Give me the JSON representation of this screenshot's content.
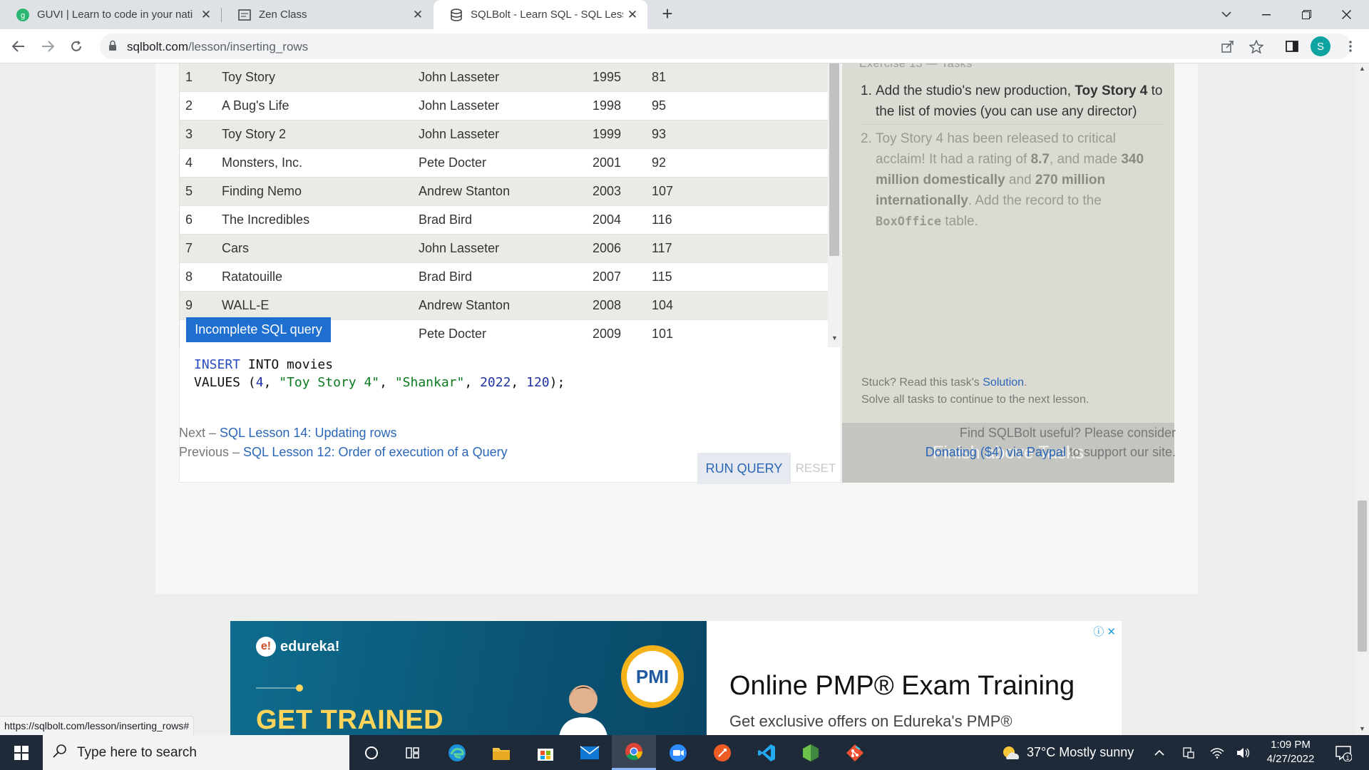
{
  "browser": {
    "tabs": [
      {
        "title": "GUVI | Learn to code in your nati",
        "icon": "guvi-icon",
        "active": false
      },
      {
        "title": "Zen Class",
        "icon": "zen-class-icon",
        "active": false
      },
      {
        "title": "SQLBolt - Learn SQL - SQL Lesson",
        "icon": "sqlbolt-icon",
        "active": true
      }
    ],
    "new_tab": "+",
    "url_host": "sqlbolt.com",
    "url_path": "/lesson/inserting_rows",
    "profile_initial": "S",
    "status_url": "https://sqlbolt.com/lesson/inserting_rows#"
  },
  "movies_table": {
    "rows": [
      {
        "id": "1",
        "title": "Toy Story",
        "director": "John Lasseter",
        "year": "1995",
        "length": "81"
      },
      {
        "id": "2",
        "title": "A Bug's Life",
        "director": "John Lasseter",
        "year": "1998",
        "length": "95"
      },
      {
        "id": "3",
        "title": "Toy Story 2",
        "director": "John Lasseter",
        "year": "1999",
        "length": "93"
      },
      {
        "id": "4",
        "title": "Monsters, Inc.",
        "director": "Pete Docter",
        "year": "2001",
        "length": "92"
      },
      {
        "id": "5",
        "title": "Finding Nemo",
        "director": "Andrew Stanton",
        "year": "2003",
        "length": "107"
      },
      {
        "id": "6",
        "title": "The Incredibles",
        "director": "Brad Bird",
        "year": "2004",
        "length": "116"
      },
      {
        "id": "7",
        "title": "Cars",
        "director": "John Lasseter",
        "year": "2006",
        "length": "117"
      },
      {
        "id": "8",
        "title": "Ratatouille",
        "director": "Brad Bird",
        "year": "2007",
        "length": "115"
      },
      {
        "id": "9",
        "title": "WALL-E",
        "director": "Andrew Stanton",
        "year": "2008",
        "length": "104"
      },
      {
        "id": "",
        "title": "",
        "director": "Pete Docter",
        "year": "2009",
        "length": "101"
      }
    ]
  },
  "query_status": "Incomplete SQL query",
  "editor": {
    "line1_kw1": "INSERT",
    "line1_rest": " INTO movies",
    "line2_kw": "VALUES",
    "line2_open": " (",
    "v1": "4",
    "v2": "\"Toy Story 4\"",
    "v3": "\"Shankar\"",
    "v4": "2022",
    "v5": "120",
    "line2_close": ");",
    "sep": ", "
  },
  "buttons": {
    "run": "RUN QUERY",
    "reset": "RESET"
  },
  "exercise": {
    "header": "Exercise 13 — Tasks",
    "task1": {
      "num": "1.",
      "pre": "Add the studio's new production, ",
      "bold": "Toy Story 4",
      "post": " to the list of movies (you can use any director)"
    },
    "task2": {
      "num": "2.",
      "p1": "Toy Story 4 has been released to critical acclaim! It had a rating of ",
      "b1": "8.7",
      "p2": ", and made ",
      "b2": "340 million domestically",
      "p3": " and ",
      "b3": "270 million internationally",
      "p4": ". Add the record to the ",
      "code": "BoxOffice",
      "p5": " table."
    },
    "stuck_pre": "Stuck? Read this task's ",
    "stuck_link": "Solution",
    "stuck_post": ".",
    "solve_all": "Solve all tasks to continue to the next lesson.",
    "finish": "Finish above Tasks"
  },
  "lesson_nav": {
    "next_label": "Next – ",
    "next_link": "SQL Lesson 14: Updating rows",
    "prev_label": "Previous – ",
    "prev_link": "SQL Lesson 12: Order of execution of a Query",
    "donate_line1": "Find SQLBolt useful? Please consider",
    "donate_link": "Donating ($4) via Paypal",
    "donate_post": " to support our site."
  },
  "ad": {
    "brand": "edureka!",
    "headline": "GET TRAINED",
    "badge": "PMI",
    "title": "Online PMP® Exam Training",
    "subtitle": "Get exclusive offers on Edureka's PMP®"
  },
  "taskbar": {
    "search_placeholder": "Type here to search",
    "weather": "37°C  Mostly sunny",
    "time": "1:09 PM",
    "date": "4/27/2022",
    "notification_count": "1"
  },
  "colors": {
    "accent_blue": "#2a66b8",
    "status_badge": "#1f6fd1",
    "finish_button": "#c4c4c0"
  }
}
